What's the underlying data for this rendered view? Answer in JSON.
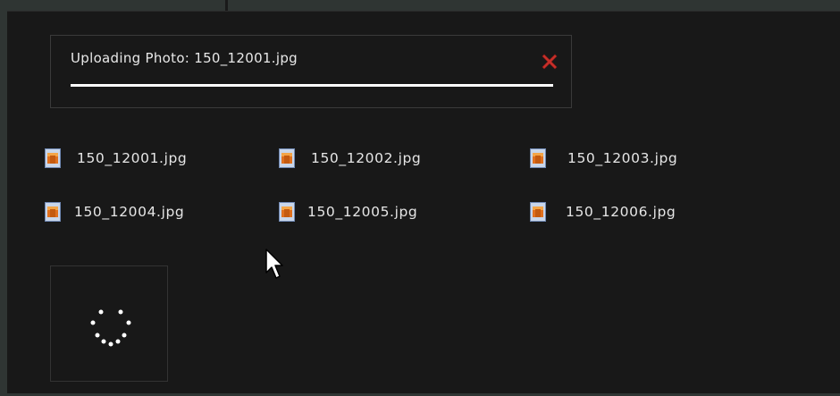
{
  "upload": {
    "title": "Uploading Photo: 150_12001.jpg",
    "progress_fraction": 1.0,
    "close_icon": "close-icon",
    "close_color": "#c8302a"
  },
  "files": [
    {
      "name": "150_12001.jpg",
      "icon": "image-file-icon"
    },
    {
      "name": "150_12002.jpg",
      "icon": "image-file-icon"
    },
    {
      "name": "150_12003.jpg",
      "icon": "image-file-icon"
    },
    {
      "name": "150_12004.jpg",
      "icon": "image-file-icon"
    },
    {
      "name": "150_12005.jpg",
      "icon": "image-file-icon"
    },
    {
      "name": "150_12006.jpg",
      "icon": "image-file-icon"
    }
  ],
  "spinner": {
    "icon": "loading-spinner-icon"
  },
  "pointer": {
    "icon": "mouse-pointer-icon"
  },
  "colors": {
    "panel_background": "#181818",
    "frame": "#2f3533",
    "text": "#e6e6e6",
    "progress": "#ffffff"
  }
}
